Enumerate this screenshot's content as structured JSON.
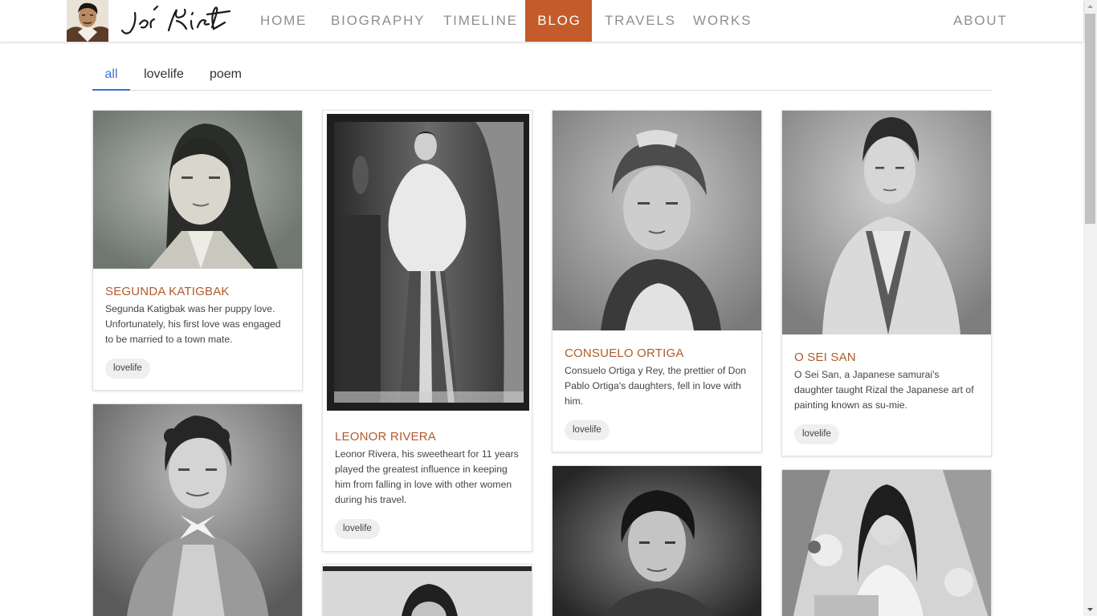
{
  "nav": {
    "items": [
      {
        "label": "HOME"
      },
      {
        "label": "BIOGRAPHY"
      },
      {
        "label": "TIMELINE"
      },
      {
        "label": "BLOG"
      },
      {
        "label": "TRAVELS"
      },
      {
        "label": "WORKS"
      }
    ],
    "about": "ABOUT",
    "active_color": "#c45b2a"
  },
  "tabs": [
    {
      "label": "all"
    },
    {
      "label": "lovelife"
    },
    {
      "label": "poem"
    }
  ],
  "cards": [
    {
      "title": "SEGUNDA KATIGBAK",
      "text": "Segunda Katigbak was her puppy love. Unfortunately, his first love was engaged to be married to a town mate.",
      "tag": "lovelife"
    },
    {
      "title": "LEONOR RIVERA",
      "text": "Leonor Rivera, his sweetheart for 11 years played the greatest influence in keeping him from falling in love with other women during his travel.",
      "tag": "lovelife"
    },
    {
      "title": "CONSUELO ORTIGA",
      "text": "Consuelo Ortiga y Rey, the prettier of Don Pablo Ortiga's daughters, fell in love with him.",
      "tag": "lovelife"
    },
    {
      "title": "O SEI SAN",
      "text": "O Sei San, a Japanese samurai's daughter taught Rizal the Japanese art of painting known as su-mie.",
      "tag": "lovelife"
    }
  ],
  "colors": {
    "accent": "#c45b2a",
    "title": "#b05a2c",
    "tab_active": "#3b73c9"
  }
}
